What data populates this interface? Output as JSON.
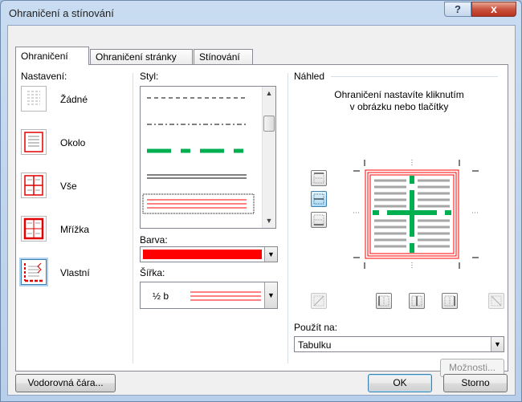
{
  "window": {
    "title": "Ohraničení a stínování",
    "help": "?",
    "close": "x"
  },
  "tabs": [
    {
      "label": "Ohraničení",
      "active": true
    },
    {
      "label": "Ohraničení stránky",
      "active": false
    },
    {
      "label": "Stínování",
      "active": false
    }
  ],
  "settings": {
    "heading": "Nastavení:",
    "items": [
      {
        "label": "Žádné",
        "icon": "border-none-icon"
      },
      {
        "label": "Okolo",
        "icon": "border-box-icon"
      },
      {
        "label": "Vše",
        "icon": "border-all-icon"
      },
      {
        "label": "Mřížka",
        "icon": "border-grid-icon"
      },
      {
        "label": "Vlastní",
        "icon": "border-custom-icon",
        "selected": true
      }
    ]
  },
  "style": {
    "heading": "Styl:",
    "selected_index": 4
  },
  "color": {
    "heading": "Barva:",
    "value": "#ff0000"
  },
  "width": {
    "heading": "Šířka:",
    "value": "½ b"
  },
  "preview": {
    "heading": "Náhled",
    "hint_line1": "Ohraničení nastavíte kliknutím",
    "hint_line2": "v obrázku nebo tlačítky"
  },
  "apply_to": {
    "heading": "Použít na:",
    "value": "Tabulku"
  },
  "buttons": {
    "options": "Možnosti...",
    "horizontal_line": "Vodorovná čára...",
    "ok": "OK",
    "cancel": "Storno"
  },
  "colors": {
    "accent_red": "#ff0000",
    "accent_green": "#00b050",
    "selection_blue": "#3c7fb1"
  }
}
